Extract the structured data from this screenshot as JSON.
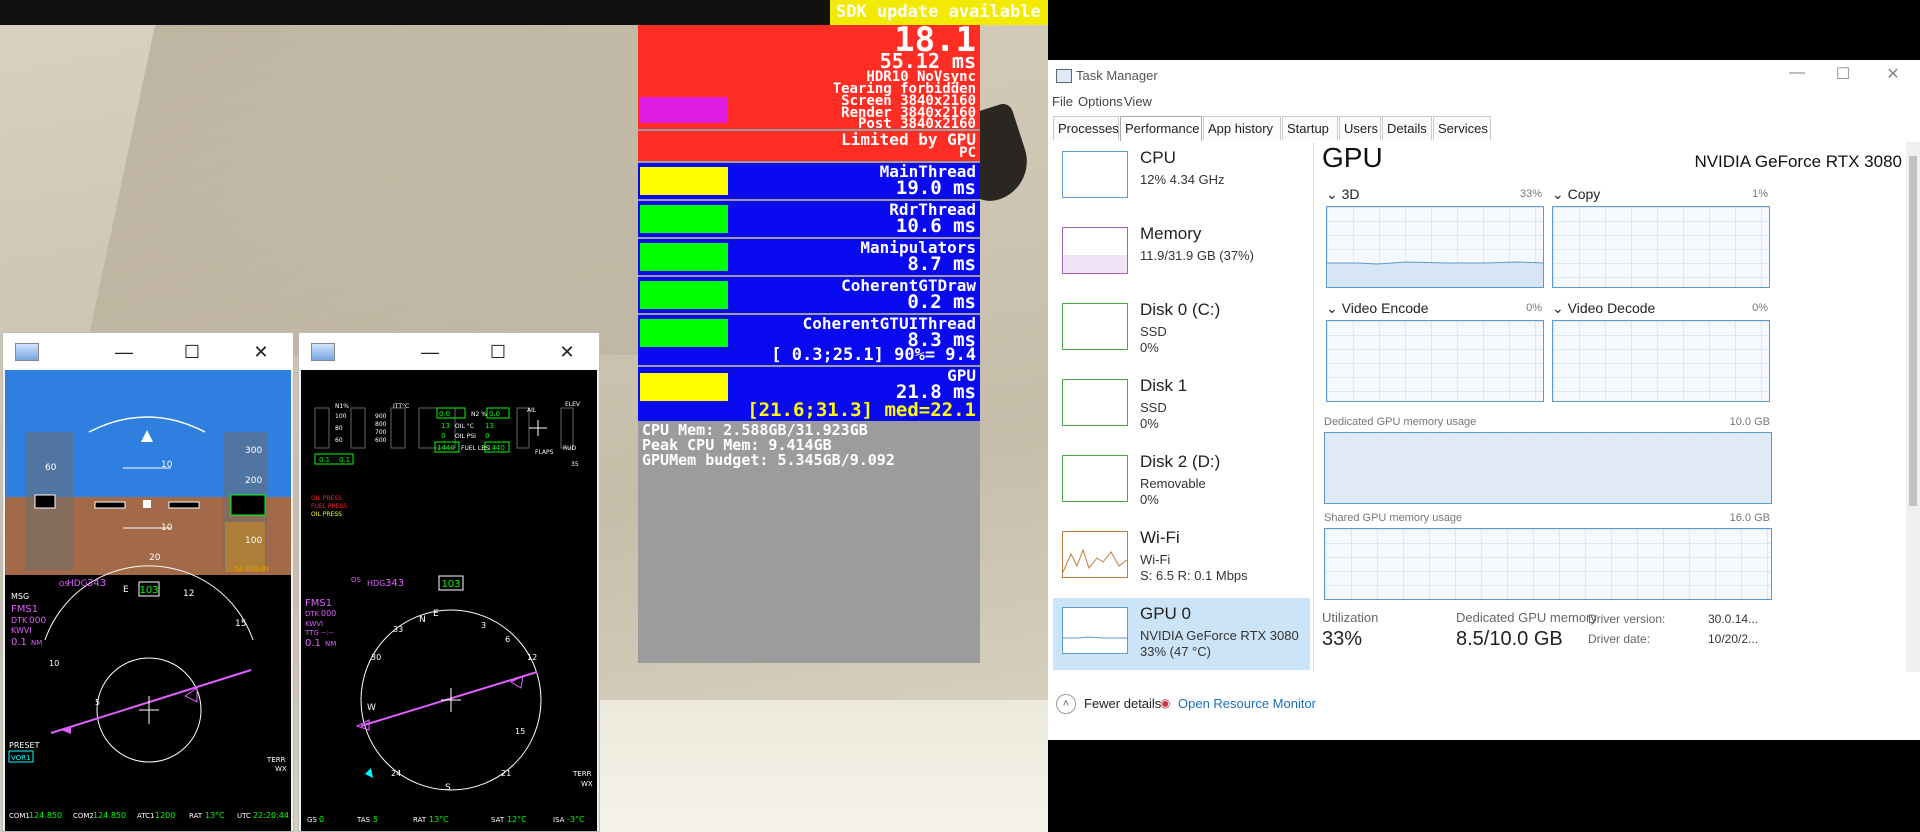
{
  "sdk_banner": "SDK update available",
  "perf": {
    "fps": "18.1",
    "frame_ms": "55.12 ms",
    "hdr": "HDR10 NoVsync",
    "tearing": "Tearing forbidden",
    "screen": "Screen 3840x2160",
    "render": "Render 3840x2160",
    "post": "Post 3840x2160",
    "limited": "Limited by GPU",
    "pc": "PC",
    "threads": [
      {
        "name": "MainThread",
        "ms": "19.0 ms",
        "bar_color": "#ffff00"
      },
      {
        "name": "RdrThread",
        "ms": "10.6 ms",
        "bar_color": "#00ff00"
      },
      {
        "name": "Manipulators",
        "ms": "8.7 ms",
        "bar_color": "#00ff00"
      },
      {
        "name": "CoherentGTDraw",
        "ms": "0.2 ms",
        "bar_color": "#00ff00"
      },
      {
        "name": "CoherentGTUIThread",
        "ms": "8.3 ms",
        "bar_color": "#00ff00"
      }
    ],
    "ui_stats": "[ 0.3;25.1] 90%= 9.4",
    "gpu_label": "GPU",
    "gpu_ms": "21.8 ms",
    "gpu_stats": "[21.6;31.3] med=22.1",
    "cpu_mem": "CPU Mem: 2.588GB/31.923GB",
    "peak_cpu_mem": "Peak CPU Mem: 9.414GB",
    "gpu_mem_budget": "GPUMem budget: 5.345GB/9.092"
  },
  "pfd_window": {
    "hdg": "HDG 343",
    "hdg_label": "HDG",
    "hdg_value": "343",
    "track": "103",
    "speed_60": "60",
    "alt_300": "300",
    "alt_200": "200",
    "alt_100": "100",
    "pitch_10a": "10",
    "pitch_10b": "10",
    "pitch_20": "20",
    "fms": "FMS1",
    "dtk": "DTK",
    "dtk_val": "000",
    "kwvi": "KWVI",
    "dist": "0.1",
    "nm": "NM",
    "msg": "MSG",
    "os": "OS",
    "preset": "PRESET",
    "vor1": "VOR1",
    "terr": "TERR",
    "wx": "WX",
    "com1_label": "COM1",
    "com1": "124.850",
    "com2_label": "COM2",
    "com2": "124.850",
    "atc1_label": "ATC1",
    "atc1": "1200",
    "rat_label": "RAT",
    "rat": "13°C",
    "utc_label": "UTC",
    "utc": "22:20:44",
    "compass_e": "E",
    "compass_12": "12",
    "compass_15": "15",
    "compass_10": "10",
    "compass_5": "5",
    "alt_box": "50,000 IN"
  },
  "eis_window": {
    "oil_press": "OIL PRESS",
    "fuel_press": "FUEL PRESS",
    "oil_press2": "OIL PRESS",
    "hdg_label": "HDG",
    "hdg_value": "343",
    "track": "103",
    "fms": "FMS1",
    "dtk": "DTK",
    "dtk_val": "000",
    "kwvi": "KWVI",
    "ttg": "TTG --:--",
    "dist": "0.1",
    "nm": "NM",
    "os": "OS",
    "terr": "TERR",
    "wx": "WX",
    "gs_label": "GS",
    "gs": "0",
    "tas_label": "TAS",
    "tas": "5",
    "rat_label": "RAT",
    "rat": "13°C",
    "sat_label": "SAT",
    "sat": "12°C",
    "isa_label": "ISA",
    "isa": "-3°C",
    "n1": "N1%",
    "itt": "ITT°C",
    "flaps": "FLAPS",
    "ail": "AIL",
    "elev": "ELEV",
    "rud": "RUD",
    "val_35": "35",
    "val_1440a": "1440",
    "val_1440b": "1440",
    "val_01a": "0.1",
    "val_01b": "0.1",
    "val_13a": "13",
    "val_13b": "13",
    "compass_e": "E",
    "compass_n": "N",
    "compass_w": "W",
    "compass_s": "S",
    "compass_12": "12",
    "compass_15": "15",
    "compass_21": "21",
    "compass_24": "24",
    "compass_30": "30",
    "compass_33": "33",
    "compass_3": "3",
    "compass_6": "6",
    "c100": "100",
    "c80": "80",
    "c60": "60",
    "c900": "900",
    "c800": "800",
    "c700": "700",
    "c600": "600",
    "oil_c": "OIL °C",
    "oil_psi": "OIL PSI",
    "fuel_lbs": "FUEL LBS",
    "zero_a": "0",
    "zero_b": "0",
    "nr_label": "N2 %",
    "nr_a": "0.0",
    "nr_b": "0.0"
  },
  "taskmgr": {
    "title": "Task Manager",
    "menu": [
      "File",
      "Options",
      "View"
    ],
    "tabs": [
      "Processes",
      "Performance",
      "App history",
      "Startup",
      "Users",
      "Details",
      "Services"
    ],
    "resources": [
      {
        "name": "CPU",
        "line1": "12%  4.34 GHz",
        "line2": ""
      },
      {
        "name": "Memory",
        "line1": "11.9/31.9 GB (37%)",
        "line2": ""
      },
      {
        "name": "Disk 0 (C:)",
        "line1": "SSD",
        "line2": "0%"
      },
      {
        "name": "Disk 1",
        "line1": "SSD",
        "line2": "0%"
      },
      {
        "name": "Disk 2 (D:)",
        "line1": "Removable",
        "line2": "0%"
      },
      {
        "name": "Wi-Fi",
        "line1": "Wi-Fi",
        "line2": "S: 6.5  R: 0.1 Mbps"
      },
      {
        "name": "GPU 0",
        "line1": "NVIDIA GeForce RTX 3080",
        "line2": "33%  (47 °C)"
      }
    ],
    "heading": "GPU",
    "gpu_name": "NVIDIA GeForce RTX 3080",
    "engines": [
      {
        "label": "3D",
        "pct": "33%"
      },
      {
        "label": "Copy",
        "pct": "1%"
      },
      {
        "label": "Video Encode",
        "pct": "0%"
      },
      {
        "label": "Video Decode",
        "pct": "0%"
      }
    ],
    "dedicated_label": "Dedicated GPU memory usage",
    "dedicated_max": "10.0 GB",
    "shared_label": "Shared GPU memory usage",
    "shared_max": "16.0 GB",
    "utilization_label": "Utilization",
    "utilization": "33%",
    "dedicated_mem_label": "Dedicated GPU memory",
    "dedicated_mem": "8.5/10.0 GB",
    "driver_version_label": "Driver version:",
    "driver_version": "30.0.14...",
    "driver_date_label": "Driver date:",
    "driver_date": "10/20/2...",
    "fewer_details": "Fewer details",
    "open_resmon": "Open Resource Monitor",
    "accent": "#5e9ad2"
  }
}
